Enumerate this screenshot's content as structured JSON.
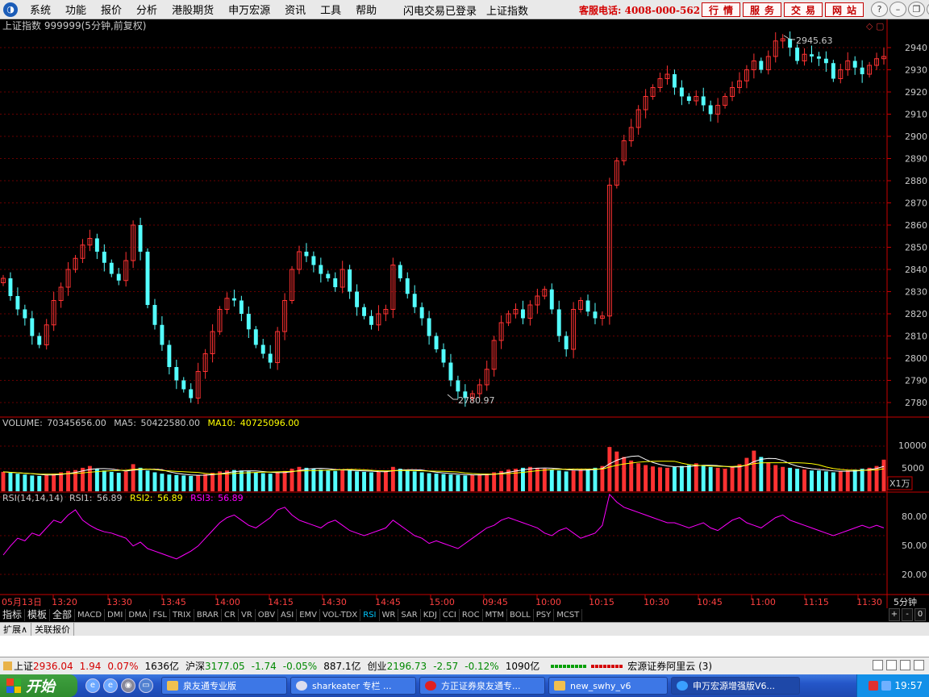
{
  "menu": {
    "logo_glyph": "◑",
    "items": [
      "系统",
      "功能",
      "报价",
      "分析",
      "港股期货",
      "申万宏源",
      "资讯",
      "工具",
      "帮助"
    ],
    "mid": [
      "闪电交易已登录",
      "上证指数"
    ],
    "hotline": "客服电话: 4008-000-562",
    "service_buttons": [
      "行情",
      "服务",
      "交易",
      "网站"
    ],
    "window_buttons": [
      "?",
      "–",
      "❐",
      "✕"
    ]
  },
  "main_chart": {
    "title": "上证指数 999999(5分钟,前复权)",
    "title_icons": "◇ ▢",
    "high_label": "2945.63",
    "low_label": "2780.97",
    "y_ticks": [
      "2940",
      "2930",
      "2920",
      "2910",
      "2900",
      "2890",
      "2880",
      "2870",
      "2860",
      "2850",
      "2840",
      "2830",
      "2820",
      "2810",
      "2800",
      "2790",
      "2780"
    ]
  },
  "volume_panel": {
    "name": "VOLUME:",
    "value": "70345656.00",
    "ma5_label": "MA5:",
    "ma5_value": "50422580.00",
    "ma10_label": "MA10:",
    "ma10_value": "40725096.00",
    "y_ticks": [
      "10000",
      "5000"
    ],
    "unit": "X1万"
  },
  "rsi_panel": {
    "name": "RSI(14,14,14)",
    "rsi1_label": "RSI1:",
    "rsi1_value": "56.89",
    "rsi2_label": "RSI2:",
    "rsi2_value": "56.89",
    "rsi3_label": "RSI3:",
    "rsi3_value": "56.89",
    "y_ticks": [
      "80.00",
      "50.00",
      "20.00"
    ]
  },
  "time_axis": {
    "date_label": "05月13日",
    "labels": [
      "13:20",
      "13:30",
      "13:45",
      "14:00",
      "14:15",
      "14:30",
      "14:45",
      "15:00",
      "09:45",
      "10:00",
      "10:15",
      "10:30",
      "10:45",
      "11:00",
      "11:15",
      "11:30"
    ],
    "period": "5分钟"
  },
  "indicator_tabs": [
    "指标",
    "模板",
    "全部",
    "MACD",
    "DMI",
    "DMA",
    "FSL",
    "TRIX",
    "BRAR",
    "CR",
    "VR",
    "OBV",
    "ASI",
    "EMV",
    "VOL-TDX",
    "RSI",
    "WR",
    "SAR",
    "KDJ",
    "CCI",
    "ROC",
    "MTM",
    "BOLL",
    "PSY",
    "MCST"
  ],
  "tab_controls": [
    "+",
    "-",
    "0"
  ],
  "ext_tabs": [
    "扩展∧",
    "关联报价"
  ],
  "status_bar": {
    "sh_label": "上证",
    "sh_value": "2936.04",
    "sh_change": "1.94",
    "sh_pct": "0.07%",
    "sh_amount": "1636亿",
    "hs_label": "沪深",
    "hs_value": "3177.05",
    "hs_change": "-1.74",
    "hs_pct": "-0.05%",
    "hs_amount": "887.1亿",
    "cy_label": "创业",
    "cy_value": "2196.73",
    "cy_change": "-2.57",
    "cy_pct": "-0.12%",
    "cy_amount": "1090亿",
    "broker": "宏源证券阿里云 (3)"
  },
  "taskbar": {
    "start": "开始",
    "tasks": [
      "泉友通专业版",
      "sharkeater 专栏 ...",
      "方正证券泉友通专...",
      "new_swhy_v6",
      "申万宏源增强版V6..."
    ],
    "clock": "19:57"
  },
  "colors": {
    "up": "#ff3232",
    "down": "#54ffff",
    "grid": "#8b0000",
    "ma5": "#ffffff",
    "ma10": "#ffff00",
    "rsi": "#ff00ff",
    "axis": "#c80000"
  },
  "chart_data": {
    "type": "candlestick",
    "series": [
      {
        "name": "close",
        "note": "5-minute index path",
        "values": [
          2836,
          2828,
          2822,
          2818,
          2810,
          2806,
          2815,
          2826,
          2832,
          2840,
          2845,
          2851,
          2854,
          2848,
          2843,
          2838,
          2835,
          2844,
          2860,
          2848,
          2824,
          2815,
          2806,
          2796,
          2790,
          2786,
          2782,
          2794,
          2802,
          2812,
          2822,
          2827,
          2826,
          2820,
          2813,
          2806,
          2802,
          2798,
          2812,
          2826,
          2840,
          2848,
          2846,
          2842,
          2838,
          2836,
          2832,
          2840,
          2830,
          2823,
          2819,
          2815,
          2820,
          2822,
          2842,
          2836,
          2829,
          2823,
          2818,
          2810,
          2804,
          2798,
          2790,
          2785,
          2782,
          2784,
          2788,
          2795,
          2808,
          2816,
          2820,
          2822,
          2818,
          2824,
          2828,
          2831,
          2822,
          2810,
          2804,
          2822,
          2826,
          2821,
          2818,
          2819,
          2878,
          2889,
          2898,
          2904,
          2912,
          2918,
          2922,
          2926,
          2928,
          2922,
          2918,
          2916,
          2918,
          2914,
          2910,
          2914,
          2918,
          2922,
          2925,
          2930,
          2934,
          2930,
          2936,
          2943,
          2944,
          2940,
          2934,
          2937,
          2936,
          2935,
          2933,
          2926,
          2930,
          2934,
          2931,
          2928,
          2932,
          2935,
          2936
        ]
      },
      {
        "name": "volume",
        "values": [
          4300,
          4100,
          3900,
          3700,
          3500,
          3400,
          3600,
          3900,
          4200,
          4500,
          4700,
          5200,
          5600,
          5000,
          4600,
          4300,
          4100,
          4400,
          6000,
          5200,
          4600,
          4200,
          3900,
          3700,
          3600,
          3500,
          3400,
          3600,
          3800,
          4100,
          4400,
          4600,
          4700,
          4600,
          4400,
          4200,
          4000,
          3900,
          4200,
          4500,
          5000,
          5400,
          5200,
          5000,
          4800,
          4600,
          4500,
          4800,
          4600,
          4400,
          4300,
          4200,
          4300,
          4500,
          5400,
          5000,
          4600,
          4400,
          4200,
          4000,
          3900,
          3800,
          3700,
          3600,
          3500,
          3600,
          3700,
          3900,
          4200,
          4500,
          4800,
          5000,
          5200,
          5400,
          5200,
          5000,
          4800,
          4600,
          4400,
          4600,
          4800,
          5000,
          5200,
          5600,
          9800,
          8800,
          7600,
          6800,
          6200,
          5800,
          5500,
          5300,
          5200,
          5400,
          5600,
          5800,
          6200,
          5800,
          5400,
          5200,
          5000,
          5400,
          6000,
          7400,
          9000,
          7600,
          6400,
          5800,
          5400,
          5200,
          5000,
          4800,
          4600,
          4600,
          4400,
          4200,
          4400,
          4600,
          4800,
          5000,
          5200,
          5600,
          7000
        ]
      },
      {
        "name": "RSI1",
        "values": [
          35,
          42,
          48,
          46,
          52,
          50,
          56,
          62,
          60,
          66,
          70,
          62,
          58,
          55,
          53,
          52,
          50,
          48,
          42,
          45,
          40,
          38,
          36,
          34,
          32,
          35,
          38,
          42,
          48,
          54,
          60,
          64,
          66,
          62,
          58,
          56,
          60,
          64,
          70,
          72,
          66,
          62,
          60,
          58,
          56,
          60,
          62,
          58,
          54,
          52,
          50,
          52,
          54,
          56,
          62,
          58,
          54,
          50,
          48,
          44,
          46,
          44,
          42,
          40,
          44,
          48,
          52,
          56,
          58,
          62,
          64,
          62,
          60,
          58,
          56,
          52,
          50,
          54,
          56,
          52,
          48,
          50,
          52,
          58,
          82,
          76,
          72,
          70,
          68,
          66,
          64,
          62,
          60,
          60,
          58,
          56,
          58,
          60,
          56,
          54,
          58,
          62,
          64,
          60,
          58,
          56,
          60,
          64,
          66,
          62,
          60,
          58,
          56,
          54,
          52,
          50,
          52,
          54,
          56,
          58,
          56,
          58,
          56
        ]
      }
    ]
  }
}
